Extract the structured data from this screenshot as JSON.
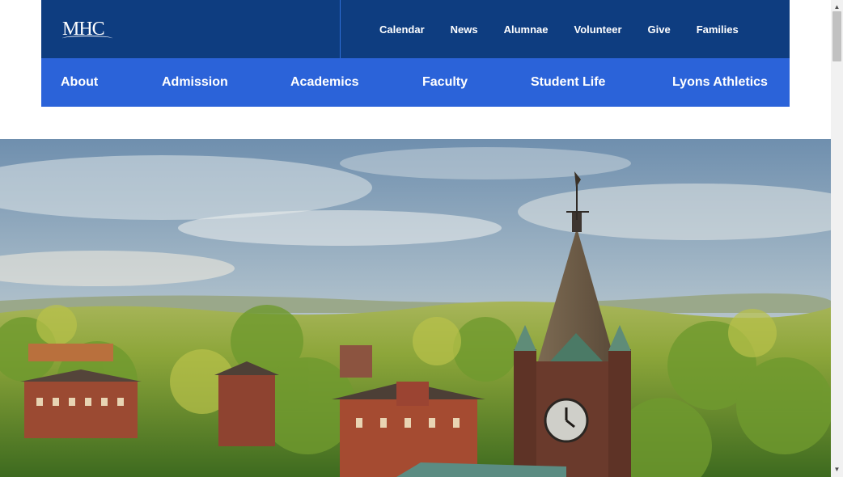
{
  "logo": {
    "text": "MHC"
  },
  "utility_nav": {
    "items": [
      "Calendar",
      "News",
      "Alumnae",
      "Volunteer",
      "Give",
      "Families"
    ]
  },
  "main_nav": {
    "items": [
      "About",
      "Admission",
      "Academics",
      "Faculty",
      "Student Life",
      "Lyons Athletics"
    ]
  },
  "hero": {
    "alt": "Aerial view of campus with clock tower"
  },
  "colors": {
    "top_bar": "#0e3d80",
    "main_nav": "#2b63d9",
    "text_on_nav": "#ffffff"
  },
  "scrollbar": {
    "up_arrow": "▲",
    "down_arrow": "▼"
  }
}
